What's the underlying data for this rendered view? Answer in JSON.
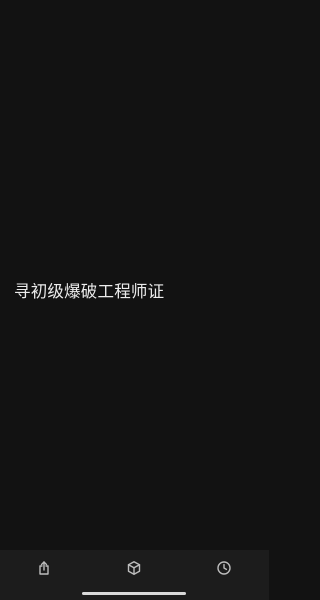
{
  "page": {
    "text": "寻初级爆破工程师证"
  },
  "toolbar": {
    "items": [
      {
        "name": "share",
        "icon": "share-icon"
      },
      {
        "name": "box",
        "icon": "cube-icon"
      },
      {
        "name": "history",
        "icon": "clock-icon"
      }
    ]
  },
  "colors": {
    "background": "#121212",
    "toolbar": "#1c1c1c",
    "text": "#ececec",
    "icon": "#bdbdbd"
  }
}
